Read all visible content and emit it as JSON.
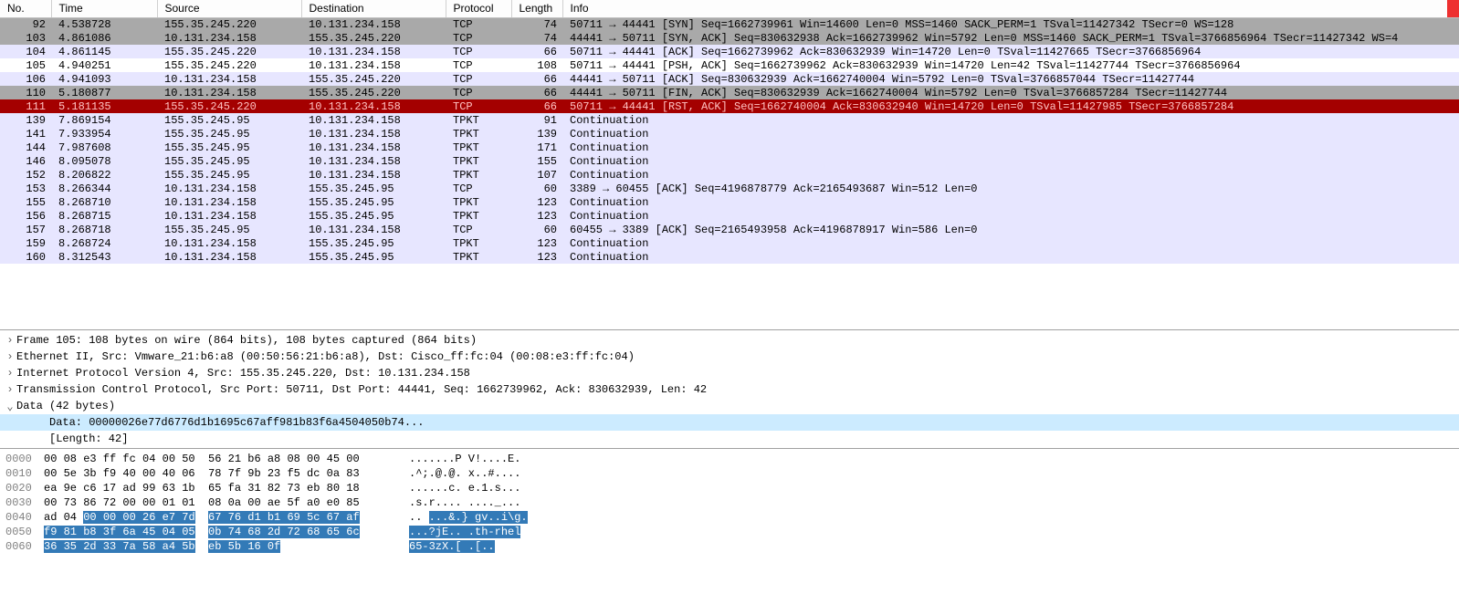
{
  "columns": {
    "no": "No.",
    "time": "Time",
    "source": "Source",
    "destination": "Destination",
    "protocol": "Protocol",
    "length": "Length",
    "info": "Info"
  },
  "packets": [
    {
      "no": "92",
      "time": "4.538728",
      "src": "155.35.245.220",
      "dst": "10.131.234.158",
      "prot": "TCP",
      "len": "74",
      "info": "50711 → 44441 [SYN] Seq=1662739961 Win=14600 Len=0 MSS=1460 SACK_PERM=1 TSval=11427342 TSecr=0 WS=128",
      "cls": "row-gray"
    },
    {
      "no": "103",
      "time": "4.861086",
      "src": "10.131.234.158",
      "dst": "155.35.245.220",
      "prot": "TCP",
      "len": "74",
      "info": "44441 → 50711 [SYN, ACK] Seq=830632938 Ack=1662739962 Win=5792 Len=0 MSS=1460 SACK_PERM=1 TSval=3766856964 TSecr=11427342 WS=4",
      "cls": "row-gray"
    },
    {
      "no": "104",
      "time": "4.861145",
      "src": "155.35.245.220",
      "dst": "10.131.234.158",
      "prot": "TCP",
      "len": "66",
      "info": "50711 → 44441 [ACK] Seq=1662739962 Ack=830632939 Win=14720 Len=0 TSval=11427665 TSecr=3766856964",
      "cls": "row-lav"
    },
    {
      "no": "105",
      "time": "4.940251",
      "src": "155.35.245.220",
      "dst": "10.131.234.158",
      "prot": "TCP",
      "len": "108",
      "info": "50711 → 44441 [PSH, ACK] Seq=1662739962 Ack=830632939 Win=14720 Len=42 TSval=11427744 TSecr=3766856964",
      "cls": "row-white"
    },
    {
      "no": "106",
      "time": "4.941093",
      "src": "10.131.234.158",
      "dst": "155.35.245.220",
      "prot": "TCP",
      "len": "66",
      "info": "44441 → 50711 [ACK] Seq=830632939 Ack=1662740004 Win=5792 Len=0 TSval=3766857044 TSecr=11427744",
      "cls": "row-lav"
    },
    {
      "no": "110",
      "time": "5.180877",
      "src": "10.131.234.158",
      "dst": "155.35.245.220",
      "prot": "TCP",
      "len": "66",
      "info": "44441 → 50711 [FIN, ACK] Seq=830632939 Ack=1662740004 Win=5792 Len=0 TSval=3766857284 TSecr=11427744",
      "cls": "row-gray"
    },
    {
      "no": "111",
      "time": "5.181135",
      "src": "155.35.245.220",
      "dst": "10.131.234.158",
      "prot": "TCP",
      "len": "66",
      "info": "50711 → 44441 [RST, ACK] Seq=1662740004 Ack=830632940 Win=14720 Len=0 TSval=11427985 TSecr=3766857284",
      "cls": "row-red",
      "mark": "└"
    },
    {
      "no": "139",
      "time": "7.869154",
      "src": "155.35.245.95",
      "dst": "10.131.234.158",
      "prot": "TPKT",
      "len": "91",
      "info": "Continuation",
      "cls": "row-lav"
    },
    {
      "no": "141",
      "time": "7.933954",
      "src": "155.35.245.95",
      "dst": "10.131.234.158",
      "prot": "TPKT",
      "len": "139",
      "info": "Continuation",
      "cls": "row-lav"
    },
    {
      "no": "144",
      "time": "7.987608",
      "src": "155.35.245.95",
      "dst": "10.131.234.158",
      "prot": "TPKT",
      "len": "171",
      "info": "Continuation",
      "cls": "row-lav"
    },
    {
      "no": "146",
      "time": "8.095078",
      "src": "155.35.245.95",
      "dst": "10.131.234.158",
      "prot": "TPKT",
      "len": "155",
      "info": "Continuation",
      "cls": "row-lav"
    },
    {
      "no": "152",
      "time": "8.206822",
      "src": "155.35.245.95",
      "dst": "10.131.234.158",
      "prot": "TPKT",
      "len": "107",
      "info": "Continuation",
      "cls": "row-lav"
    },
    {
      "no": "153",
      "time": "8.266344",
      "src": "10.131.234.158",
      "dst": "155.35.245.95",
      "prot": "TCP",
      "len": "60",
      "info": "3389 → 60455 [ACK] Seq=4196878779 Ack=2165493687 Win=512 Len=0",
      "cls": "row-lav"
    },
    {
      "no": "155",
      "time": "8.268710",
      "src": "10.131.234.158",
      "dst": "155.35.245.95",
      "prot": "TPKT",
      "len": "123",
      "info": "Continuation",
      "cls": "row-lav"
    },
    {
      "no": "156",
      "time": "8.268715",
      "src": "10.131.234.158",
      "dst": "155.35.245.95",
      "prot": "TPKT",
      "len": "123",
      "info": "Continuation",
      "cls": "row-lav"
    },
    {
      "no": "157",
      "time": "8.268718",
      "src": "155.35.245.95",
      "dst": "10.131.234.158",
      "prot": "TCP",
      "len": "60",
      "info": "60455 → 3389 [ACK] Seq=2165493958 Ack=4196878917 Win=586 Len=0",
      "cls": "row-lav"
    },
    {
      "no": "159",
      "time": "8.268724",
      "src": "10.131.234.158",
      "dst": "155.35.245.95",
      "prot": "TPKT",
      "len": "123",
      "info": "Continuation",
      "cls": "row-lav"
    },
    {
      "no": "160",
      "time": "8.312543",
      "src": "10.131.234.158",
      "dst": "155.35.245.95",
      "prot": "TPKT",
      "len": "123",
      "info": "Continuation",
      "cls": "row-lav"
    }
  ],
  "details": [
    {
      "tw": ">",
      "text": "Frame 105: 108 bytes on wire (864 bits), 108 bytes captured (864 bits)",
      "sel": false
    },
    {
      "tw": ">",
      "text": "Ethernet II, Src: Vmware_21:b6:a8 (00:50:56:21:b6:a8), Dst: Cisco_ff:fc:04 (00:08:e3:ff:fc:04)",
      "sel": false
    },
    {
      "tw": ">",
      "text": "Internet Protocol Version 4, Src: 155.35.245.220, Dst: 10.131.234.158",
      "sel": false
    },
    {
      "tw": ">",
      "text": "Transmission Control Protocol, Src Port: 50711, Dst Port: 44441, Seq: 1662739962, Ack: 830632939, Len: 42",
      "sel": false
    },
    {
      "tw": "v",
      "text": "Data (42 bytes)",
      "sel": false
    },
    {
      "tw": "",
      "indent": 2,
      "text": "Data: 00000026e77d6776d1b1695c67aff981b83f6a4504050b74...",
      "sel": true
    },
    {
      "tw": "",
      "indent": 2,
      "text": "[Length: 42]",
      "sel": false
    }
  ],
  "hex": [
    {
      "off": "0000",
      "b1": "00 08 e3 ff fc 04 00 50",
      "b2": "56 21 b6 a8 08 00 45 00",
      "a": ".......P V!....E."
    },
    {
      "off": "0010",
      "b1": "00 5e 3b f9 40 00 40 06",
      "b2": "78 7f 9b 23 f5 dc 0a 83",
      "a": ".^;.@.@. x..#...."
    },
    {
      "off": "0020",
      "b1": "ea 9e c6 17 ad 99 63 1b",
      "b2": "65 fa 31 82 73 eb 80 18",
      "a": "......c. e.1.s..."
    },
    {
      "off": "0030",
      "b1": "00 73 86 72 00 00 01 01",
      "b2": "08 0a 00 ae 5f a0 e0 85",
      "a": ".s.r.... ...._..."
    },
    {
      "off": "0040",
      "b1": "ad 04 ",
      "b1sel": "00 00 00 26 e7 7d",
      "b2sel": "67 76 d1 b1 69 5c 67 af",
      "a": ".. ",
      "asel": "...&.} gv..i\\g."
    },
    {
      "off": "0050",
      "b1sel": "f9 81 b8 3f 6a 45 04 05",
      "b2sel": "0b 74 68 2d 72 68 65 6c",
      "asel": "...?jE.. .th-rhel"
    },
    {
      "off": "0060",
      "b1sel": "36 35 2d 33 7a 58 a4 5b",
      "b2sel": "eb 5b 16 0f",
      "asel": "65-3zX.[ .[.."
    }
  ]
}
